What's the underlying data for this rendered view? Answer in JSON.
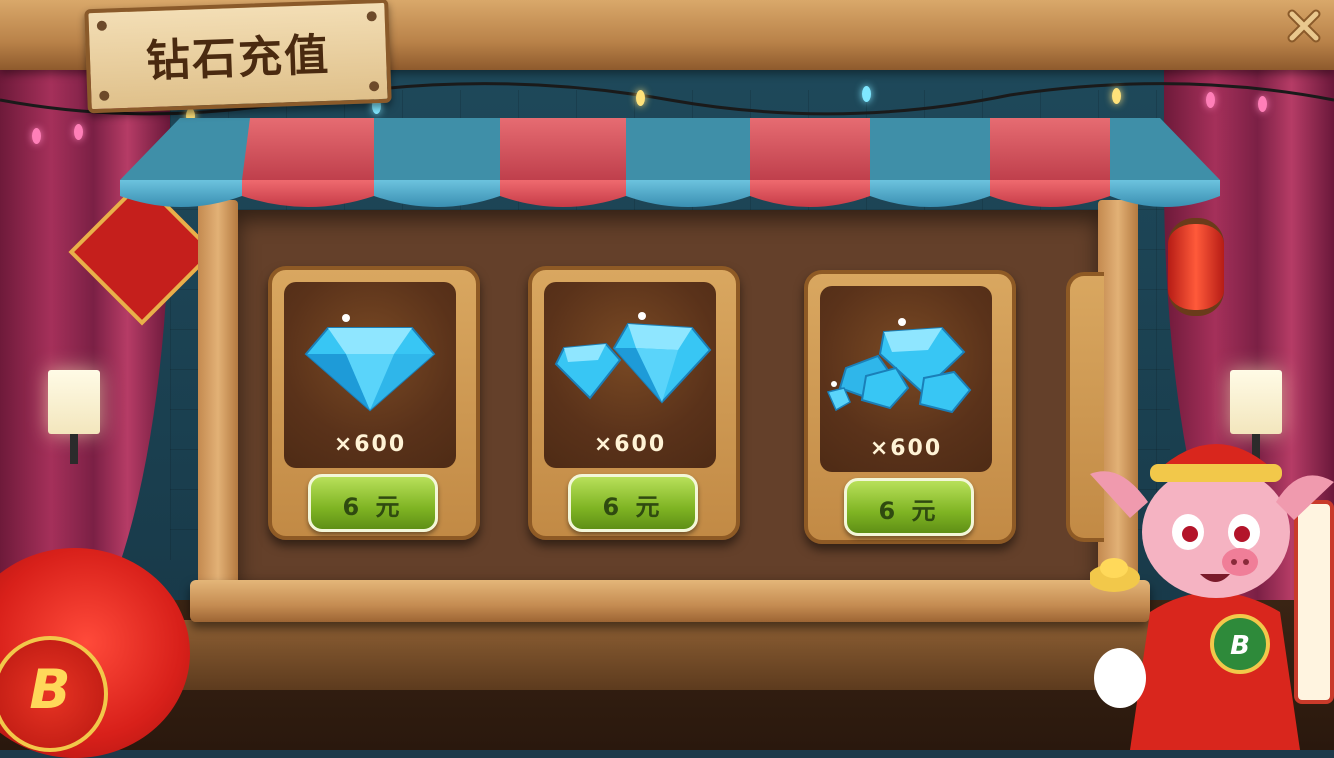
{
  "header": {
    "title": "钻石充值",
    "close_icon": "close-x-icon"
  },
  "shop": {
    "items": [
      {
        "icon": "single-diamond-icon",
        "count": "×600",
        "price": "6 元"
      },
      {
        "icon": "double-diamond-icon",
        "count": "×600",
        "price": "6 元"
      },
      {
        "icon": "diamond-pile-icon",
        "count": "×600",
        "price": "6 元"
      }
    ]
  },
  "decor": {
    "lantern_logo": "B",
    "colors": {
      "awning_red": "#d94b55",
      "awning_blue": "#4fa8c8",
      "price_button_green": "#7fb423",
      "wood": "#c28a45",
      "gem_blue": "#38c6f4"
    }
  }
}
